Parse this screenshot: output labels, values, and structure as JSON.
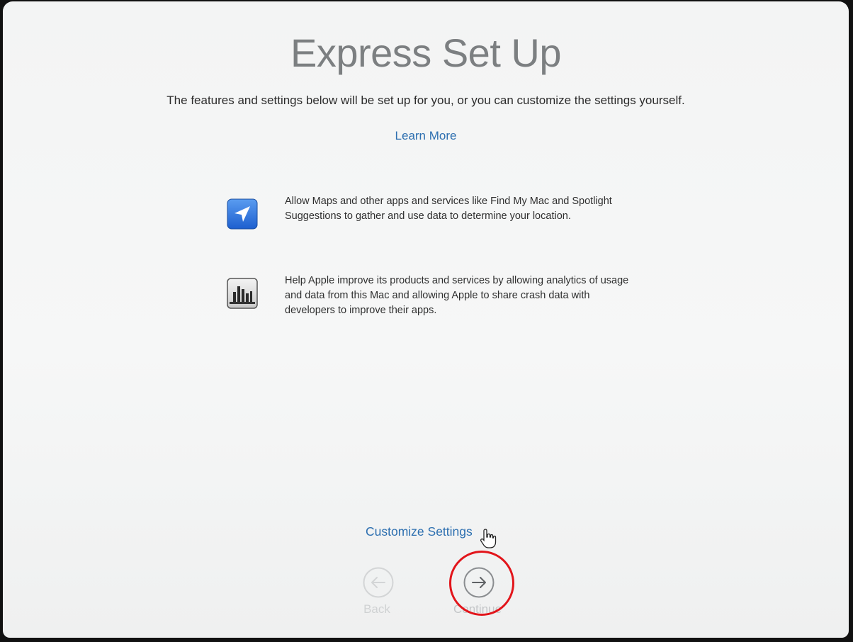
{
  "window": {
    "title": "Express Set Up",
    "subtitle": "The features and settings below will be set up for you, or you can customize the settings yourself.",
    "learn_more": "Learn More"
  },
  "features": [
    {
      "icon": "location-arrow-icon",
      "text": "Allow Maps and other apps and services like Find My Mac and Spotlight Suggestions to gather and use data to determine your location."
    },
    {
      "icon": "analytics-chart-icon",
      "text": "Help Apple improve its products and services by allowing analytics of usage and data from this Mac and allowing Apple to share crash data with developers to improve their apps."
    }
  ],
  "footer": {
    "customize_label": "Customize Settings",
    "back_label": "Back",
    "continue_label": "Continue"
  },
  "colors": {
    "link": "#2d6fb0",
    "title": "#7c7f81",
    "highlight": "#e2151b"
  }
}
